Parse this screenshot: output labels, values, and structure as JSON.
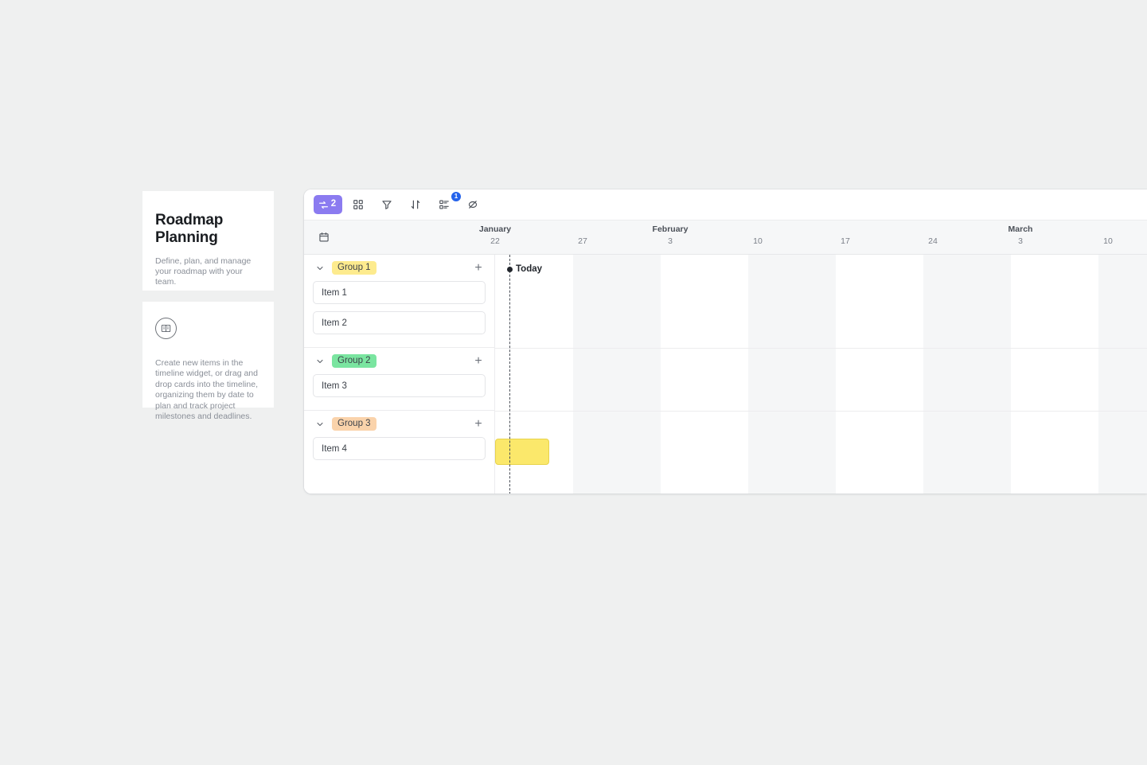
{
  "sidebar": {
    "title": "Roadmap Planning",
    "subtitle": "Define, plan, and manage your roadmap with your team.",
    "help_icon": "book-icon",
    "help_text": "Create new items in the timeline widget, or drag and drop cards into the timeline, organizing them by date to plan and track project milestones and deadlines."
  },
  "toolbar": {
    "buttons": [
      {
        "name": "sync-button",
        "icon": "sync-icon",
        "label": "2",
        "active": true,
        "badge": null
      },
      {
        "name": "grid-view-button",
        "icon": "grid-icon",
        "label": "",
        "active": false,
        "badge": null
      },
      {
        "name": "filter-button",
        "icon": "filter-icon",
        "label": "",
        "active": false,
        "badge": null
      },
      {
        "name": "sort-button",
        "icon": "sort-icon",
        "label": "",
        "active": false,
        "badge": null
      },
      {
        "name": "group-button",
        "icon": "group-by-icon",
        "label": "",
        "active": false,
        "badge": "1"
      },
      {
        "name": "hide-fields-button",
        "icon": "eye-off-icon",
        "label": "",
        "active": false,
        "badge": null
      }
    ],
    "active_color": "#8b7bf0",
    "badge_color": "#2563eb"
  },
  "timeline": {
    "header_icon": "calendar-icon",
    "scale": [
      {
        "month": "January",
        "day": "22"
      },
      {
        "month": "",
        "day": "27"
      },
      {
        "month": "February",
        "day": "3"
      },
      {
        "month": "",
        "day": "10"
      },
      {
        "month": "",
        "day": "17"
      },
      {
        "month": "",
        "day": "24"
      },
      {
        "month": "March",
        "day": "3"
      },
      {
        "month": "",
        "day": "10"
      }
    ],
    "today_label": "Today",
    "bars": [
      {
        "name": "item-4-bar",
        "group": 2,
        "color": "#fbe86b",
        "border": "#e8d34c",
        "left": 0,
        "width": 66
      }
    ]
  },
  "groups": [
    {
      "name": "Group 1",
      "badge_bg": "#fdeb8e",
      "add_label": "+",
      "items": [
        {
          "label": "Item 1"
        },
        {
          "label": "Item 2"
        }
      ]
    },
    {
      "name": "Group 2",
      "badge_bg": "#7ae5a0",
      "add_label": "+",
      "items": [
        {
          "label": "Item 3"
        }
      ]
    },
    {
      "name": "Group 3",
      "badge_bg": "#fad3ab",
      "add_label": "+",
      "items": [
        {
          "label": "Item 4"
        }
      ]
    }
  ]
}
